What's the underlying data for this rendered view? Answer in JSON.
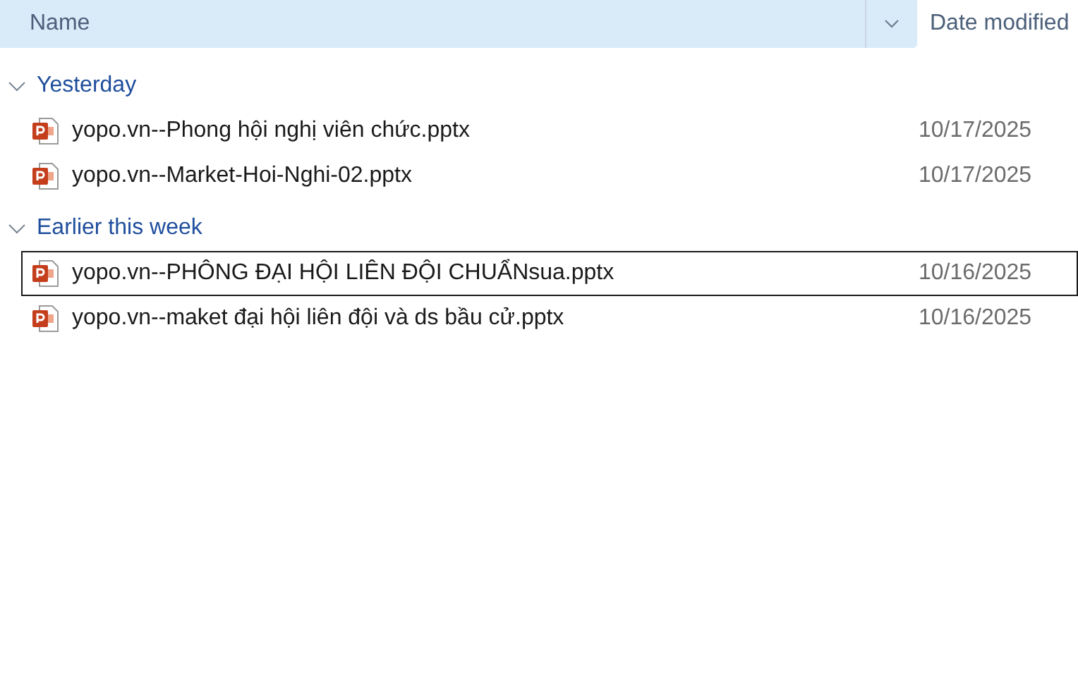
{
  "columns": [
    {
      "label": "Name",
      "selected": true
    },
    {
      "label": "Date modified",
      "selected": false
    }
  ],
  "groups": [
    {
      "label": "Yesterday",
      "expanded": true,
      "files": [
        {
          "name": "yopo.vn--Phong hội nghị viên chức.pptx",
          "date": "10/17/2025",
          "focused": false
        },
        {
          "name": "yopo.vn--Market-Hoi-Nghi-02.pptx",
          "date": "10/17/2025",
          "focused": false
        }
      ]
    },
    {
      "label": "Earlier this week",
      "expanded": true,
      "files": [
        {
          "name": "yopo.vn--PHÔNG ĐẠI HỘI LIÊN ĐỘI CHUẨNsua.pptx",
          "date": "10/16/2025",
          "focused": true
        },
        {
          "name": "yopo.vn--maket đại hội liên đội và ds bầu cử.pptx",
          "date": "10/16/2025",
          "focused": false
        }
      ]
    }
  ]
}
